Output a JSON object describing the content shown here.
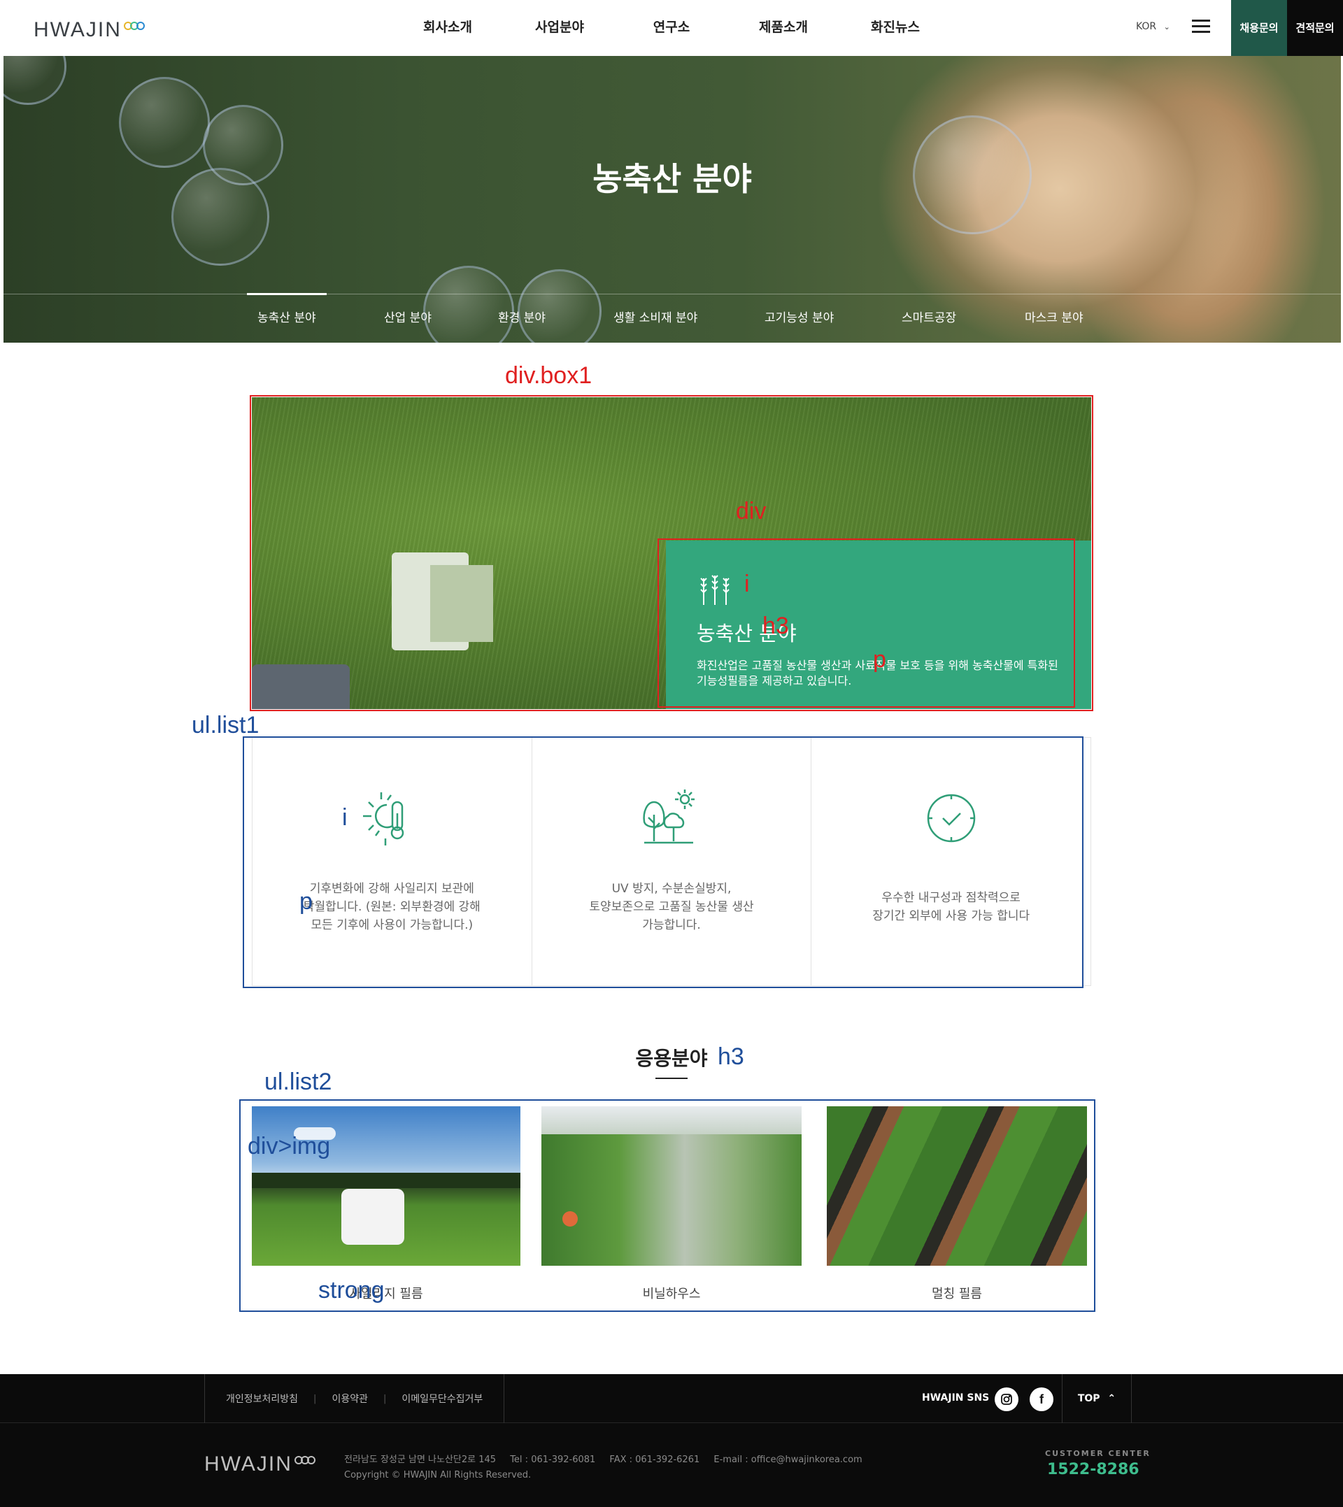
{
  "header": {
    "logo_text": "HWAJIN",
    "nav": [
      "회사소개",
      "사업분야",
      "연구소",
      "제품소개",
      "화진뉴스"
    ],
    "lang": "KOR",
    "btn_recruit": "채용문의",
    "btn_estimate": "견적문의",
    "colors": {
      "recruit_bg": "#205849",
      "estimate_bg": "#0b0b0b"
    }
  },
  "hero": {
    "title": "농축산 분야",
    "tabs": [
      "농축산 분야",
      "산업 분야",
      "환경 분야",
      "생활 소비재 분야",
      "고기능성 분야",
      "스마트공장",
      "마스크 분야"
    ],
    "active_tab": "농축산 분야"
  },
  "box1": {
    "icon": "wheat-icon",
    "title": "농축산 분야",
    "desc": "화진산업은 고품질 농산물 생산과 사료작물 보호 등을 위해 농축산물에 특화된 기능성필름을 제공하고 있습니다.",
    "card_color": "#33a77d"
  },
  "list1": [
    {
      "icon": "sun-thermometer-icon",
      "text": "기후변화에 강해 사일리지 보관에\n탁월합니다. (원본: 외부환경에 강해\n모든 기후에 사용이 가능합니다.)"
    },
    {
      "icon": "tree-sun-icon",
      "text": "UV 방지, 수분손실방지,\n토양보존으로 고품질 농산물 생산\n가능합니다."
    },
    {
      "icon": "clock-check-icon",
      "text": "우수한 내구성과 점착력으로\n장기간 외부에 사용 가능 합니다"
    }
  ],
  "application": {
    "title": "응용분야",
    "items": [
      {
        "label": "사일리지 필름"
      },
      {
        "label": "비닐하우스"
      },
      {
        "label": "멀칭 필름"
      }
    ]
  },
  "annotations": {
    "box1": "div.box1",
    "div": "div",
    "i_red": "i",
    "h3_red": "h3",
    "p_red": "p",
    "list1": "ul.list1",
    "i_blue": "i",
    "p_blue": "p",
    "h3_blue": "h3",
    "list2": "ul.list2",
    "img": "div>img",
    "strong": "strong"
  },
  "footer": {
    "links": [
      "개인정보처리방침",
      "이용약관",
      "이메일무단수집거부"
    ],
    "sns_label": "HWAJIN SNS",
    "sns": [
      "instagram-icon",
      "facebook-icon"
    ],
    "top_label": "TOP",
    "address": "전라남도 장성군 남면 나노산단2로 145",
    "tel": "Tel : 061-392-6081",
    "fax": "FAX : 061-392-6261",
    "email": "E-mail : office@hwajinkorea.com",
    "copyright": "Copyright © HWAJIN All Rights Reserved.",
    "cc_label": "CUSTOMER CENTER",
    "cc_tel": "1522-8286",
    "accent": "#3ebd8d"
  }
}
